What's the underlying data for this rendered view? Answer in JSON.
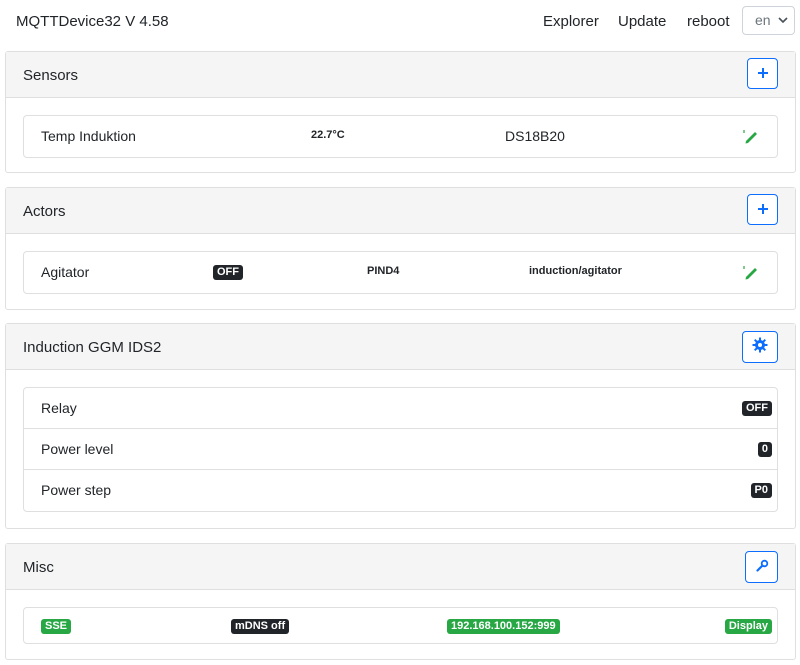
{
  "nav": {
    "brand": "MQTTDevice32 V 4.58",
    "explorer": "Explorer",
    "update": "Update",
    "reboot": "reboot",
    "language": "en"
  },
  "sensors": {
    "title": "Sensors",
    "add_icon": "plus-icon",
    "items": [
      {
        "name": "Temp Induktion",
        "value": "22.7°C",
        "type": "DS18B20"
      }
    ]
  },
  "actors": {
    "title": "Actors",
    "add_icon": "plus-icon",
    "items": [
      {
        "name": "Agitator",
        "state": "OFF",
        "pin": "PIND4",
        "topic": "induction/agitator"
      }
    ]
  },
  "induction": {
    "title": "Induction GGM IDS2",
    "settings_icon": "gear-icon",
    "rows": [
      {
        "label": "Relay",
        "value": "OFF"
      },
      {
        "label": "Power level",
        "value": "0"
      },
      {
        "label": "Power step",
        "value": "P0"
      }
    ]
  },
  "misc": {
    "title": "Misc",
    "tools_icon": "wrench-icon",
    "sse": "SSE",
    "mdns": "mDNS off",
    "ip": "192.168.100.152:999",
    "display": "Display"
  },
  "colors": {
    "accent": "#0d6efd",
    "success": "#28a745",
    "dark": "#212529",
    "header_bg": "#f5f5f5"
  }
}
